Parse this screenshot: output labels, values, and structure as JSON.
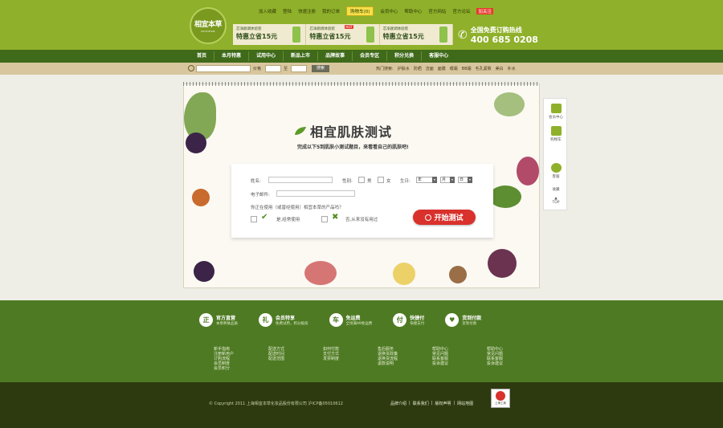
{
  "header": {
    "logo": {
      "title": "相宜本草",
      "subtitle": "INOHERB"
    },
    "top_links": [
      "加入收藏",
      "登陆",
      "快速注册",
      "我的订单",
      "购物车",
      "会员中心",
      "帮助中心",
      "官方网站",
      "官方论坛",
      "加关注"
    ],
    "cart_count": "0",
    "banners": [
      {
        "line1": "芯净颜调体验装",
        "line2": "特惠立省15元",
        "tag": ""
      },
      {
        "line1": "芯净颜调体验装",
        "line2": "特惠立省15元",
        "tag": "HOT"
      },
      {
        "line1": "芯净颜调体验装",
        "line2": "特惠立省15元",
        "tag": ""
      }
    ],
    "hotline": {
      "label": "全国免费订购热线",
      "number": "400 685 0208"
    }
  },
  "nav": [
    "首页",
    "本月特惠",
    "试用中心",
    "新品上市",
    "品牌故事",
    "会员专区",
    "积分兑换",
    "客服中心"
  ],
  "search": {
    "price_label": "价格",
    "to_label": "至",
    "button": "搜索",
    "hot_words": [
      "热门搜索:",
      "护肤水",
      "防晒",
      "洁面",
      "面膜",
      "眼霜",
      "BB霜",
      "毛孔紧致",
      "美白",
      "补水"
    ]
  },
  "quiz": {
    "title": "相宜肌肤测试",
    "subtitle": "完成以下5到肌肤小测试题目，来看看自己的肌肤吧!",
    "name_label": "姓名:",
    "gender_label": "性别:",
    "male": "男",
    "female": "女",
    "birthday_label": "生日:",
    "year": "年",
    "month": "月",
    "day": "日",
    "email_label": "电子邮件:",
    "question": "你正在使用（或曾经使用）相宜本草的产品吗？",
    "yes": "是,经常使用",
    "no": "否,从来没有用过",
    "start": "开始测试"
  },
  "side": [
    "会员中心",
    "购物车",
    "客服",
    "收藏",
    "TOP"
  ],
  "features": [
    {
      "icon": "正",
      "t1": "官方直营",
      "t2": "本草养肤品质"
    },
    {
      "icon": "礼",
      "t1": "会员特享",
      "t2": "免费试用，积分抵扣"
    },
    {
      "icon": "车",
      "t1": "免运费",
      "t2": "全场满99免运费"
    },
    {
      "icon": "付",
      "t1": "快捷付",
      "t2": "快捷支付"
    },
    {
      "icon": "♥",
      "t1": "货到付款",
      "t2": "货到付款"
    }
  ],
  "link_cols": [
    [
      "新手指南",
      "注册新用户",
      "订购流程",
      "会员制度",
      "会员积分"
    ],
    [
      "配送方式",
      "配送时间",
      "配送范围"
    ],
    [
      "如何付款",
      "支付方式",
      "发票制度"
    ],
    [
      "售后服务",
      "退换货政策",
      "退换货流程",
      "退款说明"
    ],
    [
      "帮助中心",
      "常见问题",
      "联系客服",
      "投诉建议"
    ],
    [
      "帮助中心",
      "常见问题",
      "联系客服",
      "投诉建议"
    ]
  ],
  "footer": {
    "copyright": "© Copyright 2011 上海相宜本草化妆品股份有限公司 沪ICP备05010612",
    "links": [
      "品牌介绍",
      "|",
      "联系我们",
      "|",
      "版权声明",
      "|",
      "网站地图"
    ],
    "seal": "上海工商"
  },
  "colors": {
    "header": "#8fb02a",
    "footer": "#4e7a23",
    "accent": "#d9312c"
  }
}
